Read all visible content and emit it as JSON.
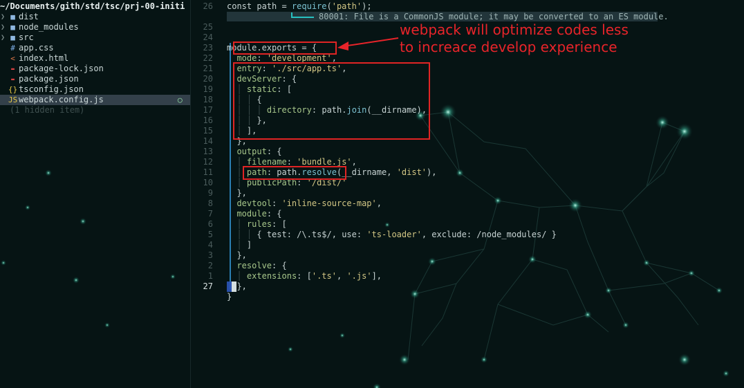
{
  "sidebar": {
    "path": "~/Documents/gith/std/tsc/prj-00-initi",
    "items": [
      {
        "label": "dist"
      },
      {
        "label": "node_modules"
      },
      {
        "label": "src"
      },
      {
        "label": "app.css"
      },
      {
        "label": "index.html"
      },
      {
        "label": "package-lock.json"
      },
      {
        "label": "package.json"
      },
      {
        "label": "tsconfig.json"
      },
      {
        "label": "webpack.config.js"
      }
    ],
    "hidden_note": "(1 hidden item)"
  },
  "editor": {
    "diagnostic": "80001: File is a CommonJS module; it may be converted to an ES module.",
    "line_numbers": [
      "26",
      "",
      "25",
      "24",
      "23",
      "22",
      "21",
      "20",
      "19",
      "18",
      "17",
      "16",
      "15",
      "14",
      "13",
      "12",
      "11",
      "10",
      "9",
      "8",
      "7",
      "6",
      "5",
      "4",
      "3",
      "2",
      "1",
      "27"
    ],
    "lines": [
      "const path = require('path');",
      "",
      "",
      "module.exports = {",
      "  mode: 'development',",
      "  entry: './src/app.ts',",
      "  devServer: {",
      "  │ static: [",
      "  │ │ {",
      "  │ │ │ directory: path.join(__dirname),",
      "  │ │ },",
      "  │ ],",
      "  },",
      "  output: {",
      "  │ filename: 'bundle.js',",
      "  │ path: path.resolve(__dirname, 'dist'),",
      "  │ publicPath: '/dist/'",
      "  },",
      "  devtool: 'inline-source-map',",
      "  module: {",
      "  │ rules: [",
      "  │ │ { test: /\\.ts$/, use: 'ts-loader', exclude: /node_modules/ }",
      "  │ ]",
      "  },",
      "  resolve: {",
      "  │ extensions: ['.ts', '.js'],",
      "  },",
      "}"
    ]
  },
  "annotation": {
    "line1": "webpack will optimize codes less",
    "line2": "to increace develop experience",
    "color": "#e8242a"
  }
}
